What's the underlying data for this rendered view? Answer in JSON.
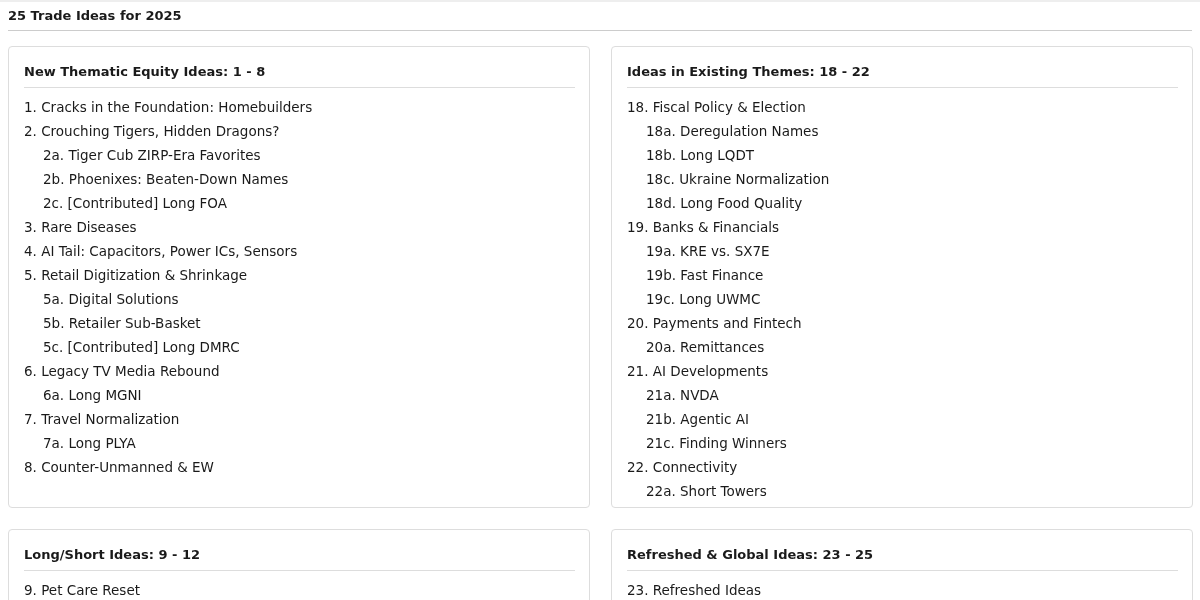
{
  "page_title": "25 Trade Ideas for 2025",
  "sections": [
    {
      "heading": "New Thematic Equity Ideas: 1 - 8",
      "items": [
        {
          "label": "1. Cracks in the Foundation: Homebuilders"
        },
        {
          "label": "2. Crouching Tigers, Hidden Dragons?",
          "children": [
            {
              "label": "2a. Tiger Cub ZIRP-Era Favorites"
            },
            {
              "label": "2b. Phoenixes: Beaten-Down Names"
            },
            {
              "label": "2c. [Contributed] Long FOA"
            }
          ]
        },
        {
          "label": "3. Rare Diseases"
        },
        {
          "label": "4. AI Tail: Capacitors, Power ICs, Sensors"
        },
        {
          "label": "5. Retail Digitization & Shrinkage",
          "children": [
            {
              "label": "5a. Digital Solutions"
            },
            {
              "label": "5b. Retailer Sub-Basket"
            },
            {
              "label": "5c. [Contributed] Long DMRC"
            }
          ]
        },
        {
          "label": "6. Legacy TV Media Rebound",
          "children": [
            {
              "label": "6a. Long MGNI"
            }
          ]
        },
        {
          "label": "7. Travel Normalization",
          "children": [
            {
              "label": "7a. Long PLYA"
            }
          ]
        },
        {
          "label": "8. Counter-Unmanned & EW"
        }
      ]
    },
    {
      "heading": "Ideas in Existing Themes: 18 - 22",
      "items": [
        {
          "label": "18. Fiscal Policy & Election",
          "children": [
            {
              "label": "18a. Deregulation Names"
            },
            {
              "label": "18b. Long LQDT"
            },
            {
              "label": "18c. Ukraine Normalization"
            },
            {
              "label": "18d. Long Food Quality"
            }
          ]
        },
        {
          "label": "19. Banks & Financials",
          "children": [
            {
              "label": "19a. KRE vs. SX7E"
            },
            {
              "label": "19b. Fast Finance"
            },
            {
              "label": "19c. Long UWMC"
            }
          ]
        },
        {
          "label": "20. Payments and Fintech",
          "children": [
            {
              "label": "20a. Remittances"
            }
          ]
        },
        {
          "label": "21. AI Developments",
          "children": [
            {
              "label": "21a. NVDA"
            },
            {
              "label": "21b. Agentic AI"
            },
            {
              "label": "21c. Finding Winners"
            }
          ]
        },
        {
          "label": "22. Connectivity",
          "children": [
            {
              "label": "22a. Short Towers"
            }
          ]
        }
      ]
    },
    {
      "heading": "Long/Short Ideas: 9 - 12",
      "items": [
        {
          "label": "9. Pet Care Reset"
        }
      ]
    },
    {
      "heading": "Refreshed & Global Ideas: 23 - 25",
      "items": [
        {
          "label": "23. Refreshed Ideas"
        }
      ]
    }
  ]
}
